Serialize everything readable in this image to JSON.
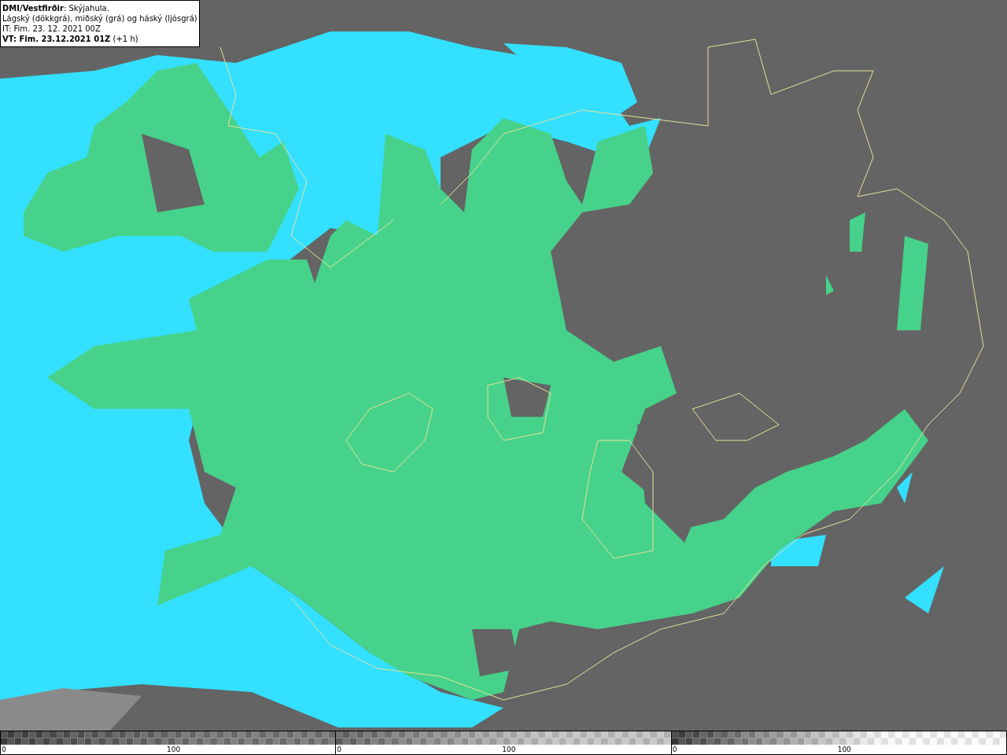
{
  "legend": {
    "lines": [
      "**DMI/Vestfirðir**: Skýjahula.",
      "Lágský (dökkgrá), miðský (grá) og háský (ljósgrá)",
      "IT: Fim. 23. 12. 2021 00Z",
      "**VT: Fim. 23.12.2021 01Z** (+1 h)"
    ]
  },
  "scales": [
    {
      "kind": "low",
      "start_label": "0",
      "mid_label": "100"
    },
    {
      "kind": "mid",
      "start_label": "0",
      "mid_label": "100"
    },
    {
      "kind": "high",
      "start_label": "0",
      "mid_label": "100"
    }
  ]
}
